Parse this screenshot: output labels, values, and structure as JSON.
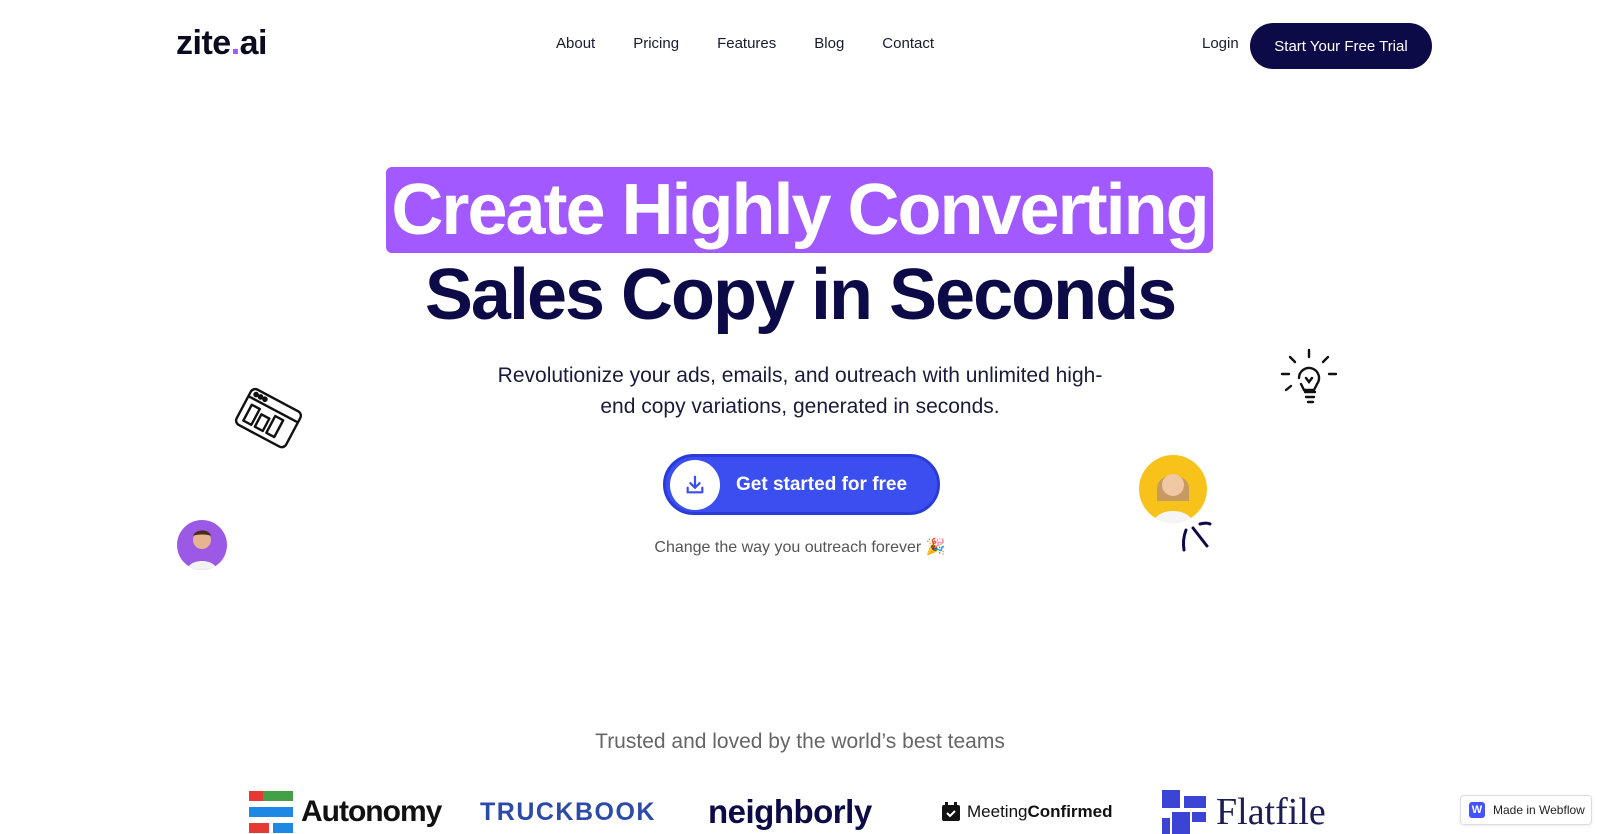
{
  "header": {
    "logo_main": "zite",
    "logo_dot": ".",
    "logo_suffix": "ai",
    "nav": [
      "About",
      "Pricing",
      "Features",
      "Blog",
      "Contact"
    ],
    "login": "Login",
    "trial_button": "Start Your Free Trial"
  },
  "hero": {
    "headline_highlight": "Create Highly Converting",
    "headline_rest": "Sales Copy in Seconds",
    "subtitle": "Revolutionize your ads, emails, and outreach with unlimited high-end copy variations, generated in seconds.",
    "cta_label": "Get started for free",
    "tagline": "Change the way you outreach forever 🎉"
  },
  "trusted": {
    "heading": "Trusted and loved by the world’s best teams",
    "logos": [
      "Autonomy",
      "TRUCKBOOK",
      "neighborly",
      "Meeting",
      "Confirmed",
      "Flatfile"
    ]
  },
  "badge": {
    "icon": "W",
    "label": "Made in Webflow"
  },
  "colors": {
    "accent_purple": "#a259ff",
    "navy": "#0d0b47",
    "cta_blue": "#3b4ff0"
  }
}
